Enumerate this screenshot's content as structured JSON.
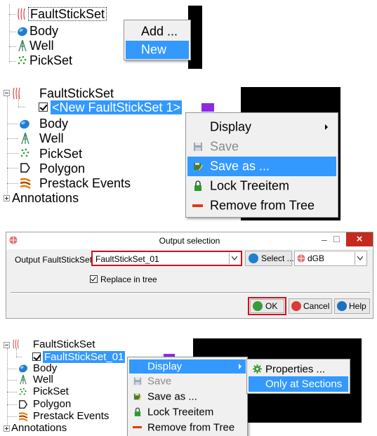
{
  "panel1": {
    "tree": {
      "faultstickset": "FaultStickSet",
      "body": "Body",
      "well": "Well",
      "pickset": "PickSet"
    },
    "menu": {
      "add": "Add ...",
      "new": "New"
    }
  },
  "panel2": {
    "tree": {
      "faultstickset": "FaultStickSet",
      "new_item": "<New FaultStickSet 1>",
      "body": "Body",
      "well": "Well",
      "pickset": "PickSet",
      "polygon": "Polygon",
      "prestack": "Prestack Events",
      "annotations": "Annotations"
    },
    "menu": {
      "display": "Display",
      "save": "Save",
      "save_as": "Save as ...",
      "lock": "Lock Treeitem",
      "remove": "Remove from Tree"
    }
  },
  "dialog": {
    "title": "Output selection",
    "output_label": "Output FaultStickSet",
    "output_value": "FaultStickSet_01",
    "select_label": "Select ...",
    "dgb_value": "dGB",
    "replace_label": "Replace in tree",
    "ok_label": "OK",
    "cancel_label": "Cancel",
    "help_label": "Help",
    "minimize_glyph": "–",
    "maximize_glyph": "□",
    "close_glyph": "×"
  },
  "panel4": {
    "tree": {
      "faultstickset": "FaultStickSet",
      "item": "FaultStickSet_01",
      "body": "Body",
      "well": "Well",
      "pickset": "PickSet",
      "polygon": "Polygon",
      "prestack": "Prestack Events",
      "annotations": "Annotations"
    },
    "menu": {
      "display": "Display",
      "save": "Save",
      "save_as": "Save as ...",
      "lock": "Lock Treeitem",
      "remove": "Remove from Tree"
    },
    "submenu": {
      "properties": "Properties ...",
      "only_sections": "Only at Sections"
    }
  },
  "colors": {
    "selection": "#3399ff",
    "highlight_box": "#d01020",
    "swatch": "#8a2be2",
    "close_button": "#c42b1c"
  }
}
